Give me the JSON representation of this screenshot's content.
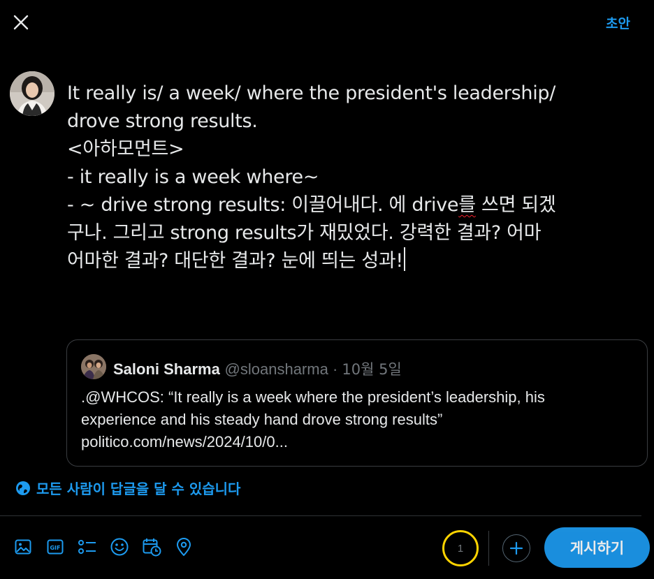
{
  "header": {
    "drafts_label": "초안"
  },
  "composer": {
    "lines": [
      "It really is/ a week/ where the president's leadership/",
      "drove strong results.",
      "<아하모먼트>",
      "- it really is a week where~",
      "- ~ drive strong results: 이끌어내다. 에 drive",
      "구나. 그리고 strong results가 재밌었다. 강력한 결과? 어마",
      "어마한 결과? 대단한 결과? 눈에 띄는 성과!"
    ],
    "spell_word": "를",
    "line5_tail": " 쓰면 되겠"
  },
  "quote": {
    "name": "Saloni Sharma",
    "handle": "@sloansharma",
    "separator": " · ",
    "date": "10월 5일",
    "body_line1": ".@WHCOS: “It really is a week where the president’s leadership, his",
    "body_line2": "experience and his steady hand drove strong results”",
    "body_line3": "politico.com/news/2024/10/0..."
  },
  "reply_setting": {
    "label": "모든 사람이 답글을 달 수 있습니다"
  },
  "counter": {
    "value": "1"
  },
  "post_button": {
    "label": "게시하기"
  },
  "colors": {
    "accent": "#1d9bf0",
    "background": "#000000",
    "text": "#e7e9ea",
    "counter_ring": "#ffd400"
  }
}
